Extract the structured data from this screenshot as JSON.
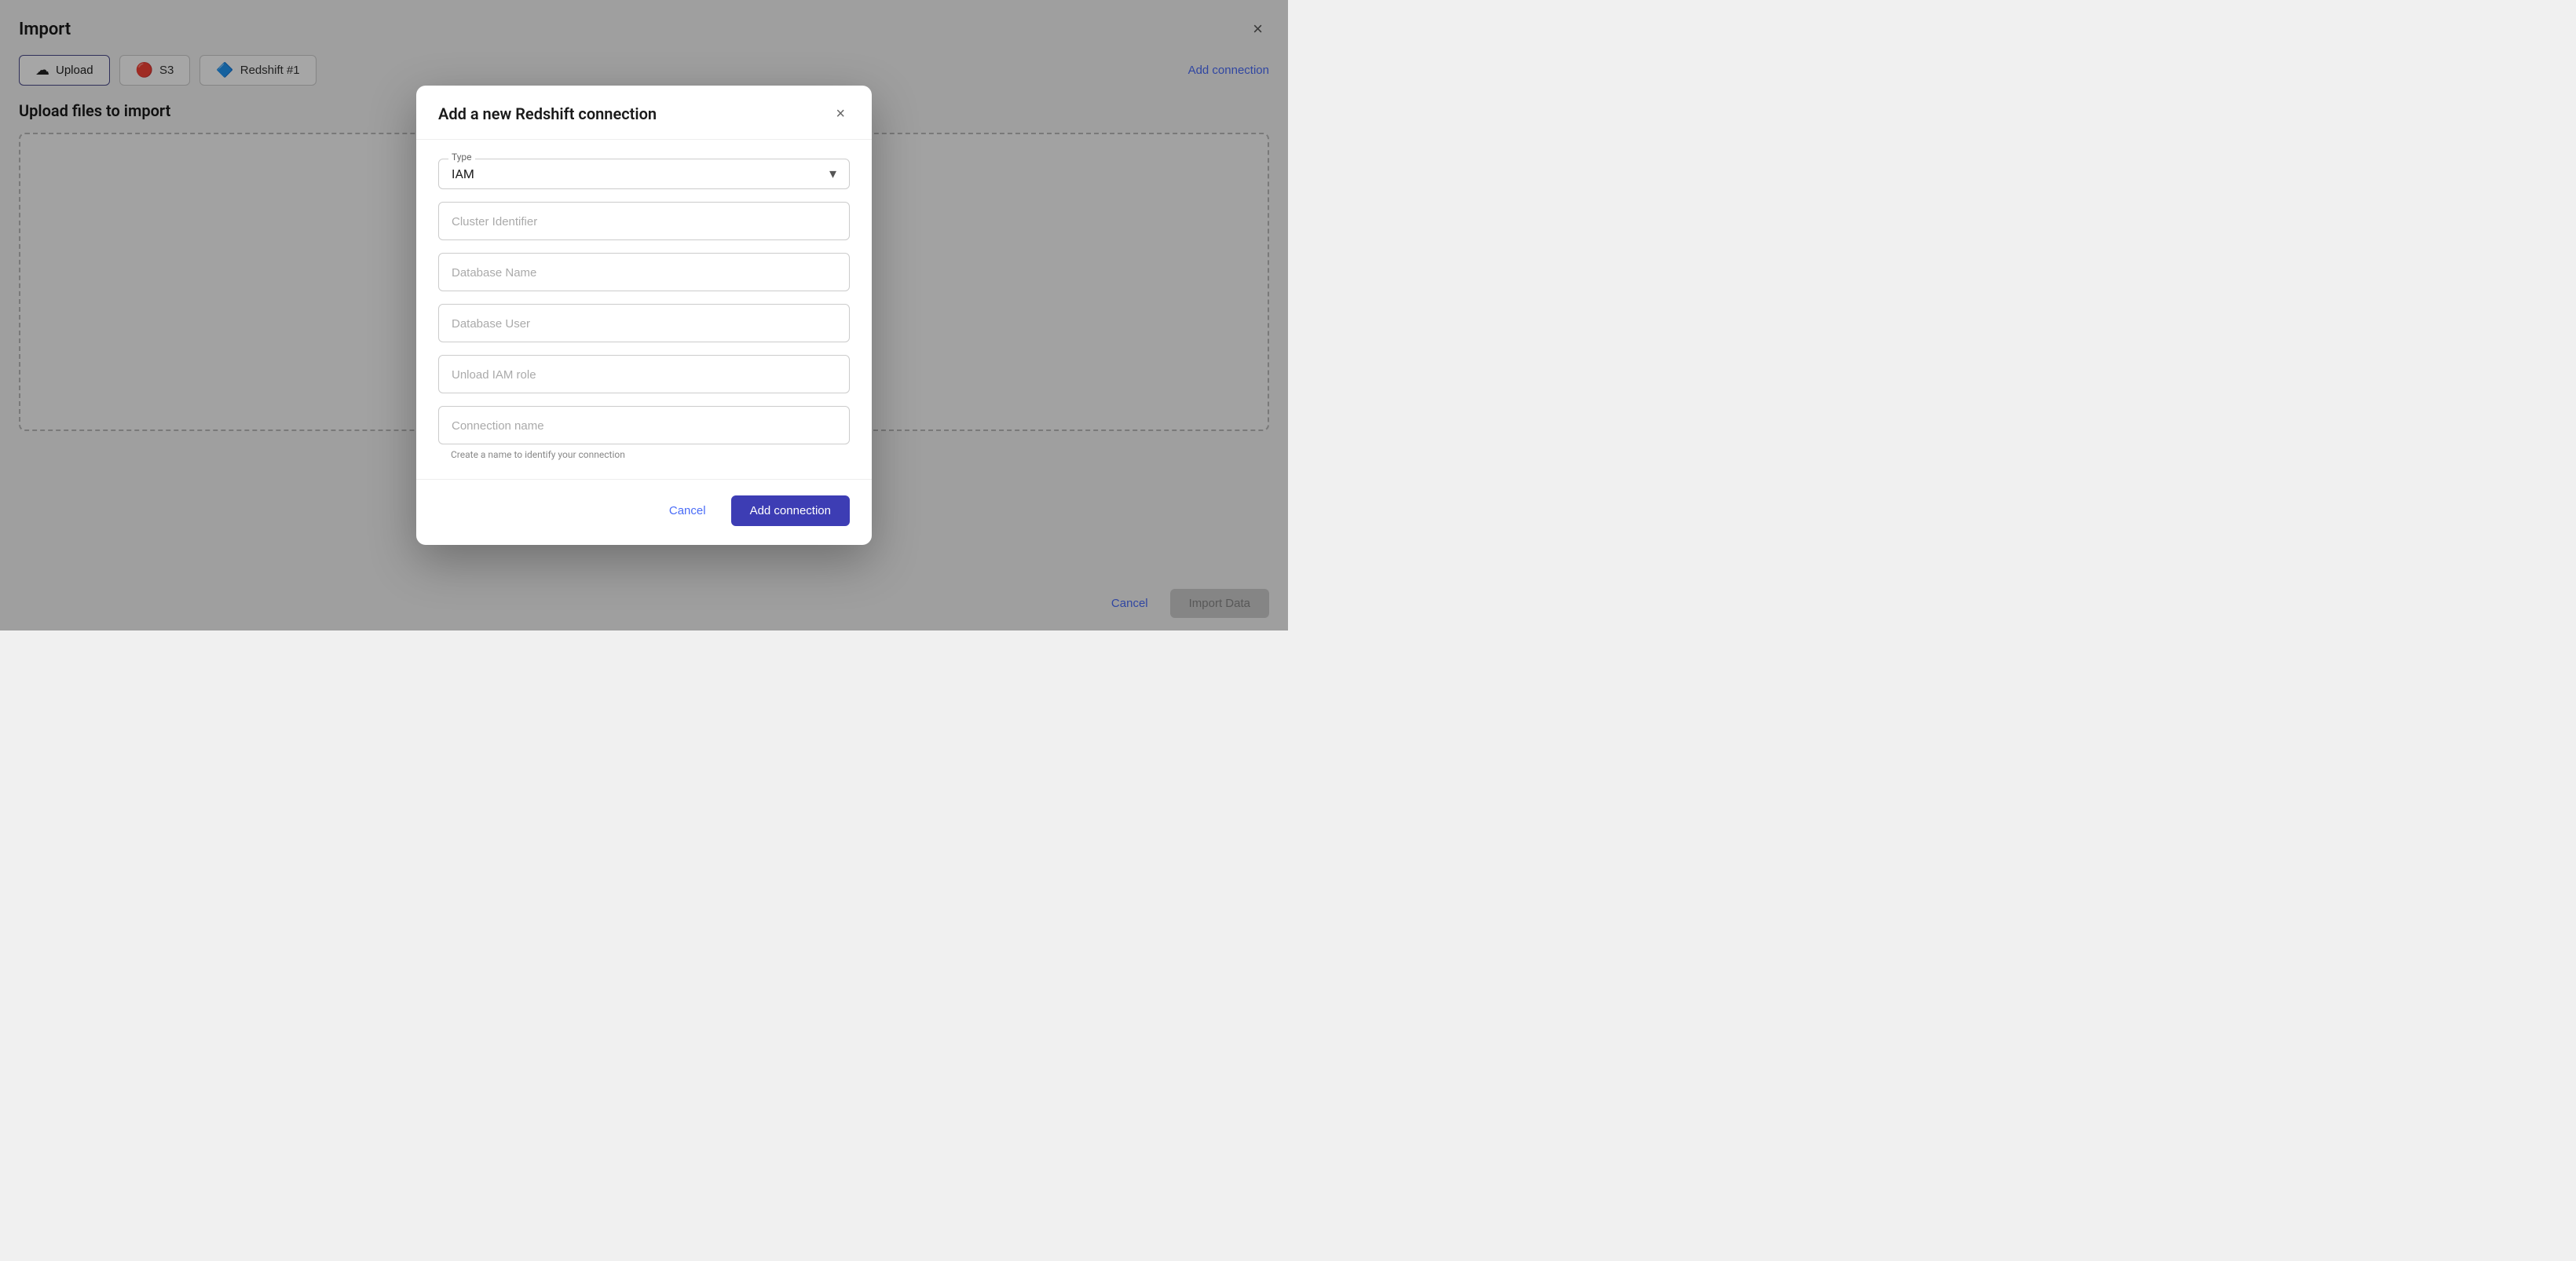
{
  "page": {
    "title": "Import",
    "close_label": "×"
  },
  "tabs": [
    {
      "id": "upload",
      "label": "Upload",
      "icon": "☁",
      "active": true
    },
    {
      "id": "s3",
      "label": "S3",
      "icon": "🔴",
      "active": false
    },
    {
      "id": "redshift",
      "label": "Redshift #1",
      "icon": "🔷",
      "active": false
    }
  ],
  "add_connection_label": "Add connection",
  "section_title": "Upload files to import",
  "bottom": {
    "cancel_label": "Cancel",
    "import_label": "Import Data"
  },
  "modal": {
    "title": "Add a new Redshift connection",
    "close_label": "×",
    "type_label": "Type",
    "type_value": "IAM",
    "fields": [
      {
        "id": "cluster_identifier",
        "placeholder": "Cluster Identifier",
        "value": ""
      },
      {
        "id": "database_name",
        "placeholder": "Database Name",
        "value": ""
      },
      {
        "id": "database_user",
        "placeholder": "Database User",
        "value": ""
      },
      {
        "id": "unload_iam_role",
        "placeholder": "Unload IAM role",
        "value": ""
      },
      {
        "id": "connection_name",
        "placeholder": "Connection name",
        "value": "",
        "hint": "Create a name to identify your connection"
      }
    ],
    "cancel_label": "Cancel",
    "add_connection_label": "Add connection"
  }
}
